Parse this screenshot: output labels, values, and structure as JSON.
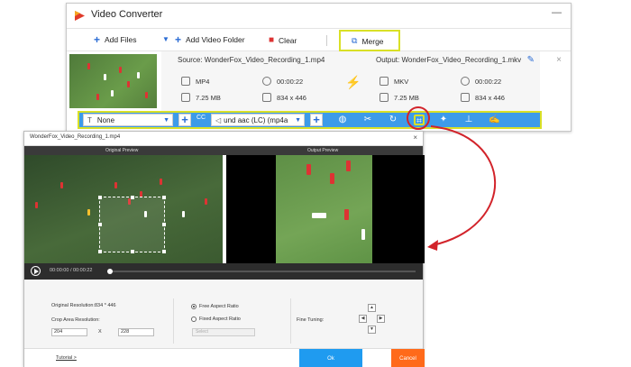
{
  "app": {
    "title": "Video Converter",
    "minimize": "—"
  },
  "toolbar": {
    "add_files": "Add Files",
    "add_video_folder": "Add Video Folder",
    "clear": "Clear",
    "merge": "Merge"
  },
  "file": {
    "source_path": "Source: WonderFox_Video_Recording_1.mp4",
    "source_format": "MP4",
    "source_duration": "00:00:22",
    "source_size": "7.25 MB",
    "source_resolution": "834 x 446",
    "output_path": "Output: WonderFox_Video_Recording_1.mkv",
    "output_format": "MKV",
    "output_duration": "00:00:22",
    "output_size": "7.25 MB",
    "output_resolution": "834 x 446"
  },
  "editbar": {
    "subtitle_select": "None",
    "audio_select": "und aac (LC) (mp4a",
    "cc_label": "CC"
  },
  "crop_window": {
    "title": "WonderFox_Video_Recording_1.mp4",
    "close": "×",
    "original_preview": "Original Preview",
    "output_preview": "Output Preview",
    "time_current": "00:00:00",
    "time_sep": "/",
    "time_total": "00:00:22",
    "original_resolution_label": "Original Resolution:",
    "original_resolution_value": "834 * 446",
    "crop_area_label": "Crop Area Resolution:",
    "crop_width": "204",
    "crop_x": "X",
    "crop_height": "228",
    "free_aspect": "Free Aspect Ratio",
    "fixed_aspect": "Fixed Aspect Ratio",
    "fixed_placeholder": "Select",
    "fine_tuning": "Fine Tuning:",
    "tutorial": "Tutorial >",
    "ok": "Ok",
    "cancel": "Cancel"
  },
  "colors": {
    "accent": "#3d9be9",
    "highlight": "#d9e026",
    "annotation": "#d2232a",
    "ok": "#1f9bf0",
    "cancel": "#ff6a1a"
  }
}
